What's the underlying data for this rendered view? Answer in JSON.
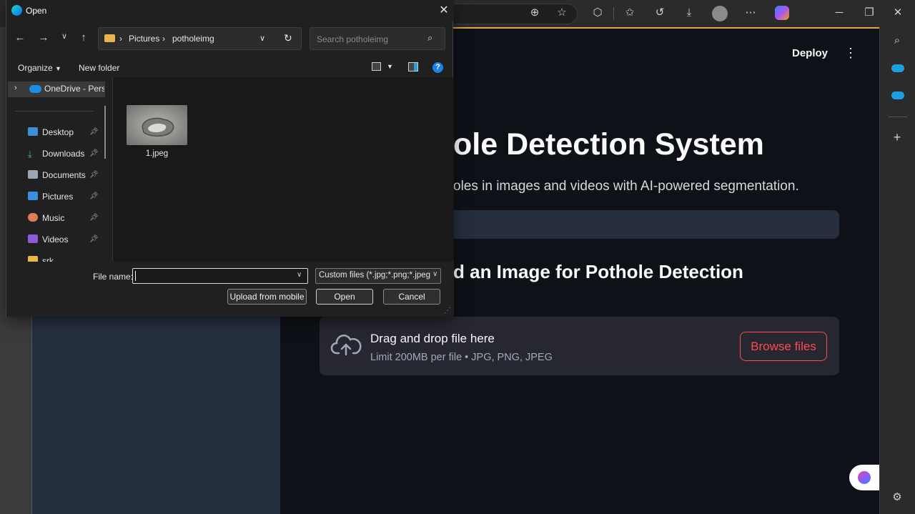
{
  "browser": {
    "sidebar_icons": [
      "search-icon",
      "cloud-icon",
      "cloud-icon",
      "plus-icon",
      "gear-icon"
    ],
    "toolbar_icons": [
      "zoom-icon",
      "star-icon",
      "extensions-icon",
      "favorites-icon",
      "history-icon",
      "download-icon",
      "profile-icon",
      "more-icon",
      "copilot-icon"
    ]
  },
  "app": {
    "deploy_label": "Deploy",
    "title": "ole Detection System",
    "subtitle": "oles in images and videos with AI-powered segmentation.",
    "upload_heading": "d an Image for Pothole Detection",
    "dropzone": {
      "title": "Drag and drop file here",
      "limit": "Limit 200MB per file • JPG, PNG, JPEG",
      "browse_label": "Browse files"
    },
    "colors": {
      "accent": "#ff4b4b",
      "background": "#0e1117"
    }
  },
  "dialog": {
    "title": "Open",
    "breadcrumb": [
      "Pictures",
      "potholeimg"
    ],
    "search_placeholder": "Search potholeimg",
    "organize_label": "Organize",
    "new_folder_label": "New folder",
    "nav_items": [
      {
        "label": "OneDrive - Perso",
        "icon": "onedrive-icon"
      },
      {
        "label": "Desktop",
        "icon": "desktop-icon"
      },
      {
        "label": "Downloads",
        "icon": "download-icon"
      },
      {
        "label": "Documents",
        "icon": "documents-icon"
      },
      {
        "label": "Pictures",
        "icon": "pictures-icon"
      },
      {
        "label": "Music",
        "icon": "music-icon"
      },
      {
        "label": "Videos",
        "icon": "videos-icon"
      },
      {
        "label": "srk",
        "icon": "folder-icon"
      }
    ],
    "files": [
      {
        "name": "1.jpeg"
      }
    ],
    "file_name_label": "File name:",
    "file_name_value": "",
    "filter_label": "Custom files (*.jpg;*.png;*.jpeg",
    "upload_mobile_label": "Upload from mobile",
    "open_label": "Open",
    "cancel_label": "Cancel"
  }
}
